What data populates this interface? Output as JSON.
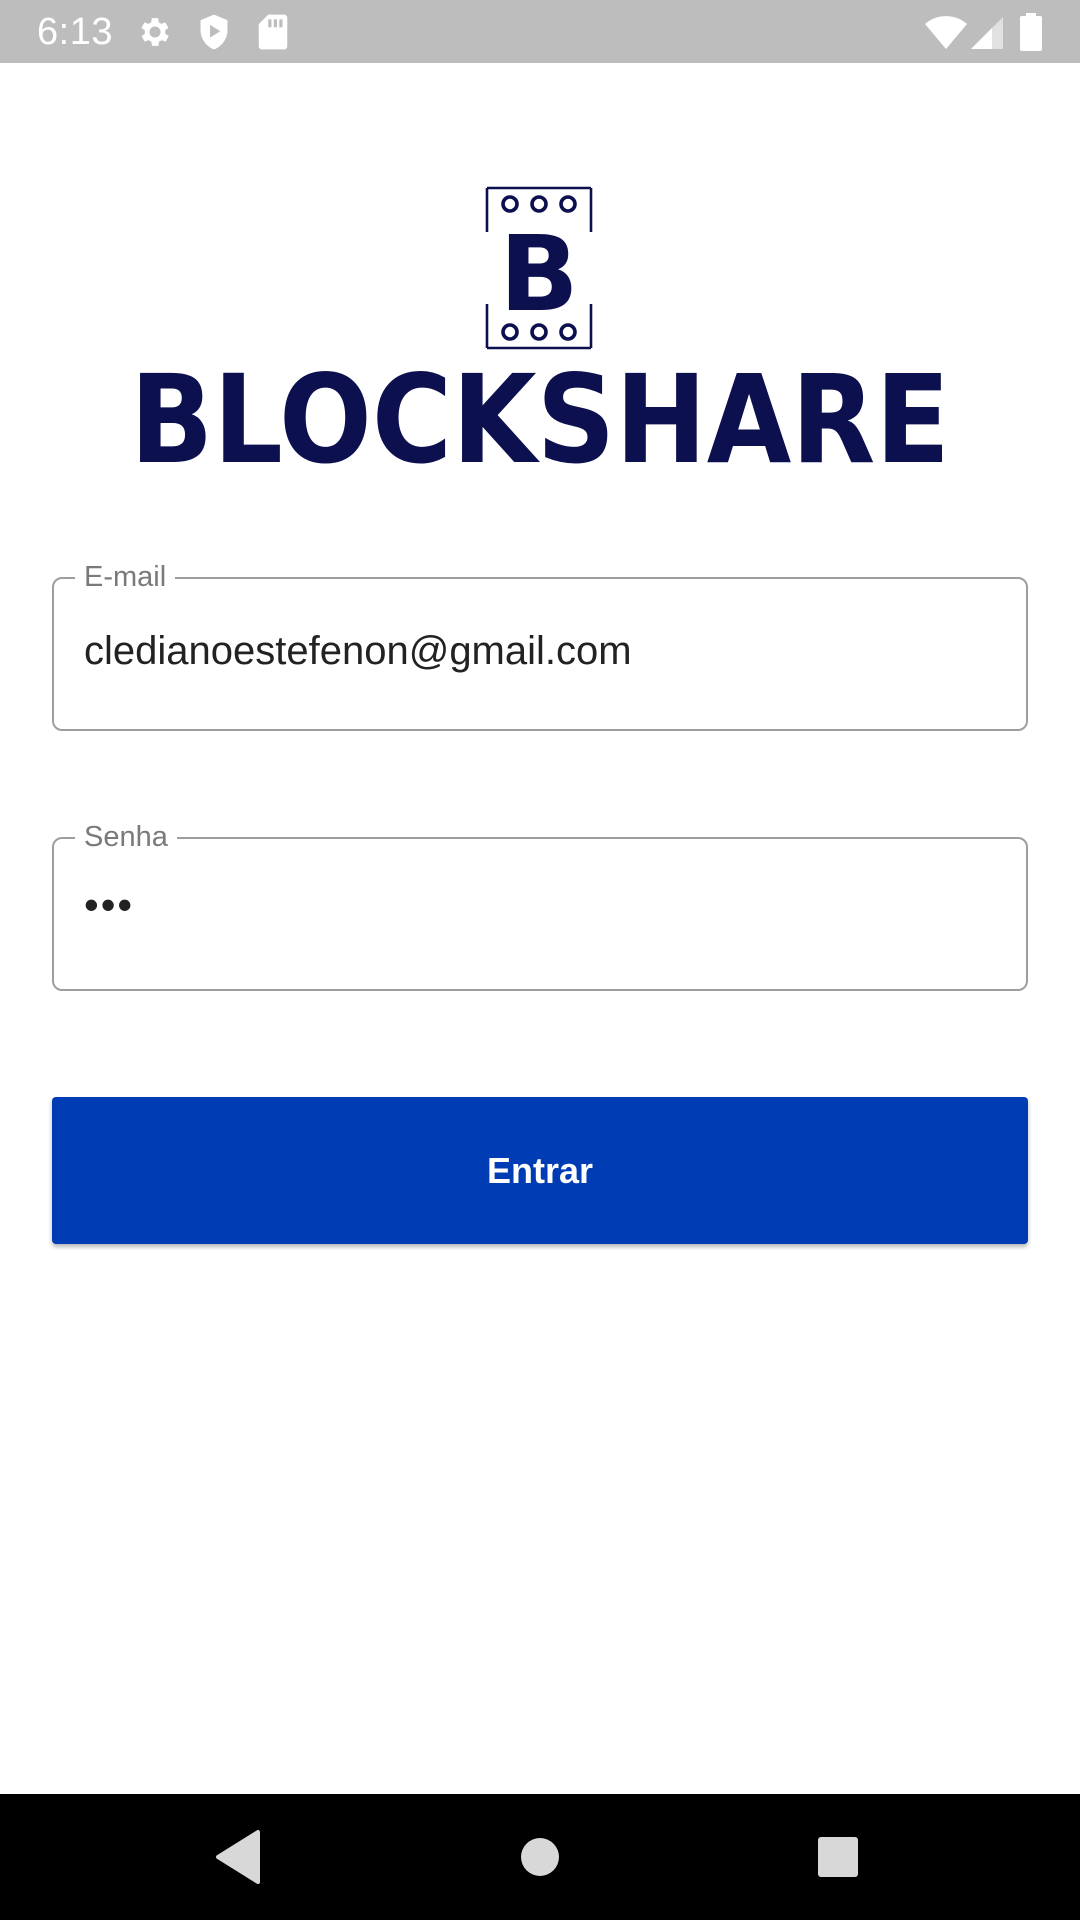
{
  "status_bar": {
    "time": "6:13",
    "left_icons": [
      "gear-icon",
      "shield-play-icon",
      "sd-card-icon"
    ],
    "right_icons": [
      "wifi-icon",
      "cell-signal-icon",
      "battery-icon"
    ]
  },
  "brand": {
    "monogram": "B",
    "name": "BLOCKSHARE",
    "color": "#0c104f"
  },
  "form": {
    "email": {
      "label": "E-mail",
      "value": "cledianoestefenon@gmail.com"
    },
    "password": {
      "label": "Senha",
      "value": "•••"
    },
    "submit_label": "Entrar",
    "button_color": "#003cb4"
  },
  "nav_bar": {
    "buttons": [
      "back-icon",
      "home-icon",
      "recents-icon"
    ]
  }
}
